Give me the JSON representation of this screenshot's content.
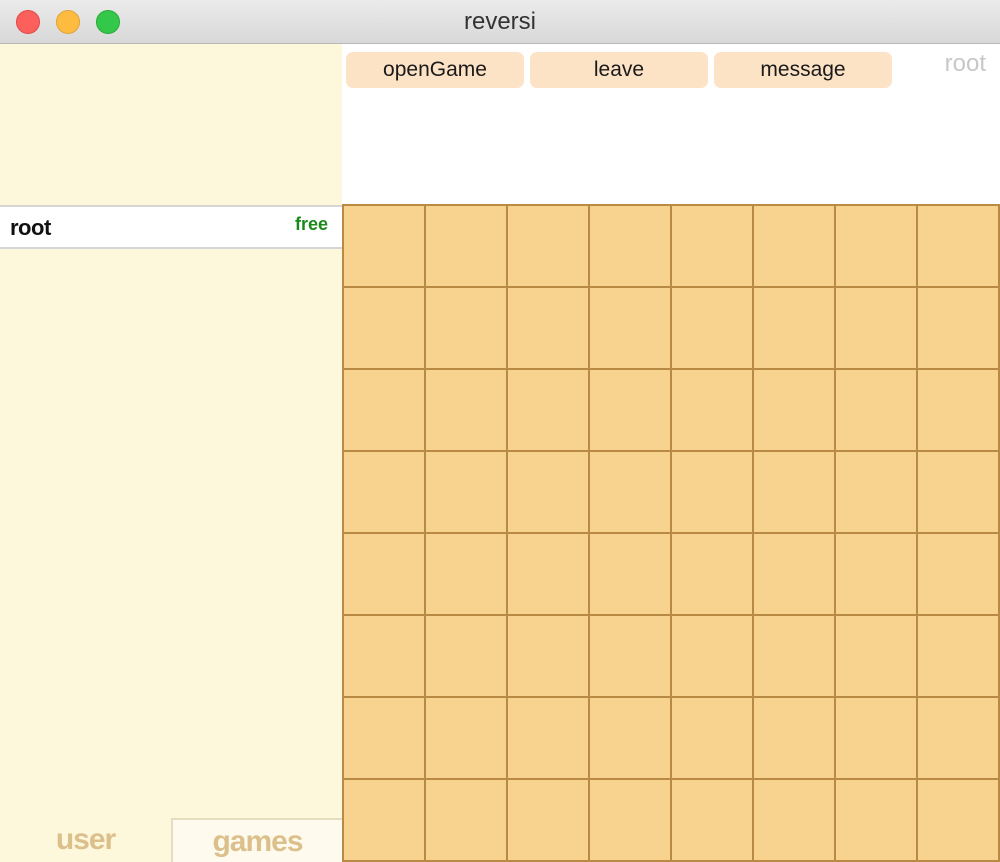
{
  "window": {
    "title": "reversi"
  },
  "toolbar": {
    "open_game_label": "openGame",
    "leave_label": "leave",
    "message_label": "message",
    "current_user": "root"
  },
  "users": [
    {
      "name": "root",
      "status": "free"
    }
  ],
  "tabs": {
    "user_label": "user",
    "games_label": "games"
  },
  "board": {
    "rows": 8,
    "cols": 8,
    "cell_color": "#f8d38f",
    "line_color": "#b98a43"
  },
  "colors": {
    "left_panel_bg": "#fdf7dc",
    "button_bg": "#fde3c6",
    "status_free": "#1b8a1b",
    "tab_text": "#dcc08c"
  }
}
